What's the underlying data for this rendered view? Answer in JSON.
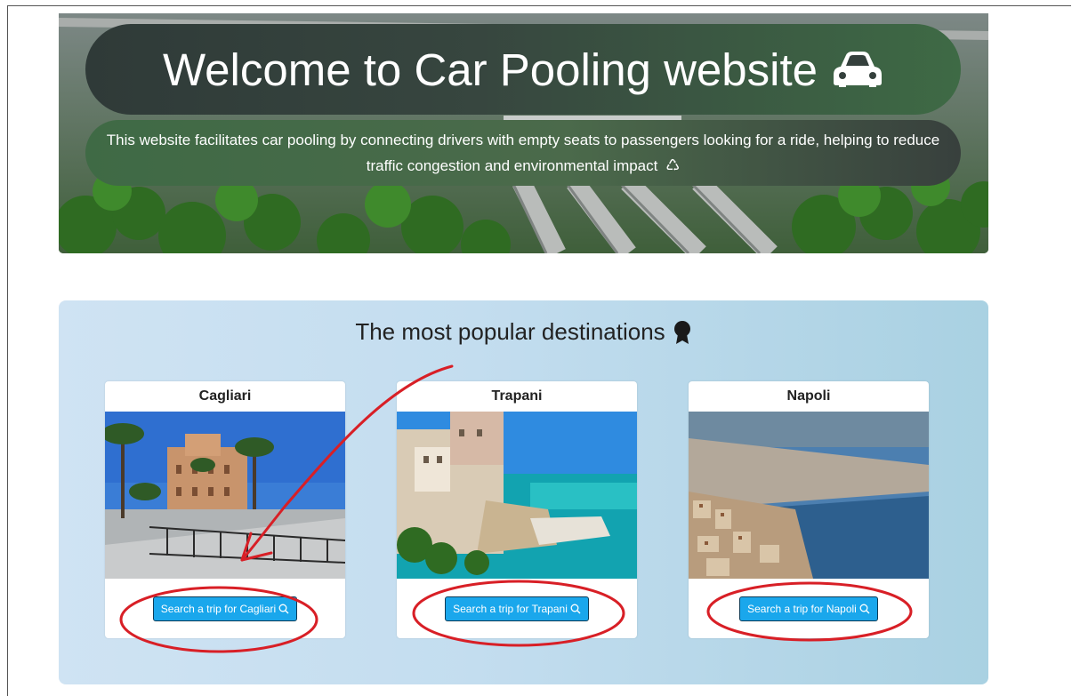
{
  "hero": {
    "title": "Welcome to Car Pooling website",
    "description": "This website facilitates car pooling by connecting drivers with empty seats to passengers looking for a ride, helping to reduce traffic congestion and environmental impact",
    "recycle_glyph": "♺"
  },
  "destinations": {
    "title": "The most popular destinations",
    "cards": [
      {
        "name": "Cagliari",
        "button": "Search a trip for Cagliari"
      },
      {
        "name": "Trapani",
        "button": "Search a trip for Trapani"
      },
      {
        "name": "Napoli",
        "button": "Search a trip for Napoli"
      }
    ]
  },
  "colors": {
    "button": "#1aa7ec",
    "annotation": "#d81f26"
  }
}
